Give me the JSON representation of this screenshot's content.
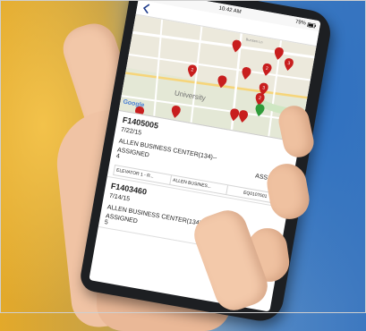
{
  "status_bar": {
    "carrier": "",
    "time": "10:42 AM",
    "battery": "79%"
  },
  "map": {
    "university_label": "University",
    "street_label": "Bunsen Ln",
    "google_label": "Google",
    "pins": [
      {
        "label": "",
        "color": "#c81e1e"
      },
      {
        "label": "",
        "color": "#c81e1e"
      },
      {
        "label": "3",
        "color": "#c81e1e"
      },
      {
        "label": "2",
        "color": "#c81e1e"
      },
      {
        "label": "",
        "color": "#c81e1e"
      },
      {
        "label": "2",
        "color": "#c81e1e"
      },
      {
        "label": "",
        "color": "#c81e1e"
      },
      {
        "label": "3",
        "color": "#c81e1e"
      },
      {
        "label": "2",
        "color": "#c81e1e"
      },
      {
        "label": "",
        "color": "#2f9b3a"
      },
      {
        "label": "",
        "color": "#c81e1e"
      },
      {
        "label": "",
        "color": "#c81e1e"
      },
      {
        "label": "",
        "color": "#c81e1e"
      },
      {
        "label": "",
        "color": "#c81e1e"
      }
    ]
  },
  "work_orders": [
    {
      "id": "F1405005",
      "date": "7/22/15",
      "location": "ALLEN BUSINESS CENTER(134)--",
      "status_left": "ASSIGNED",
      "status_right": "ASSIGNED",
      "priority": "4",
      "tags": [
        "ELEVATOR 1 - R...",
        "ALLEN BUSINES...",
        "EQ0107601"
      ]
    },
    {
      "id": "F1403460",
      "date": "7/14/15",
      "location": "ALLEN BUSINESS CENTER(134)--",
      "status_left": "ASSIGNED",
      "status_right": "",
      "priority": "5",
      "tags": []
    }
  ],
  "colors": {
    "pin_red": "#c81e1e",
    "pin_green": "#2f9b3a",
    "accent_blue": "#1d3a8a"
  }
}
